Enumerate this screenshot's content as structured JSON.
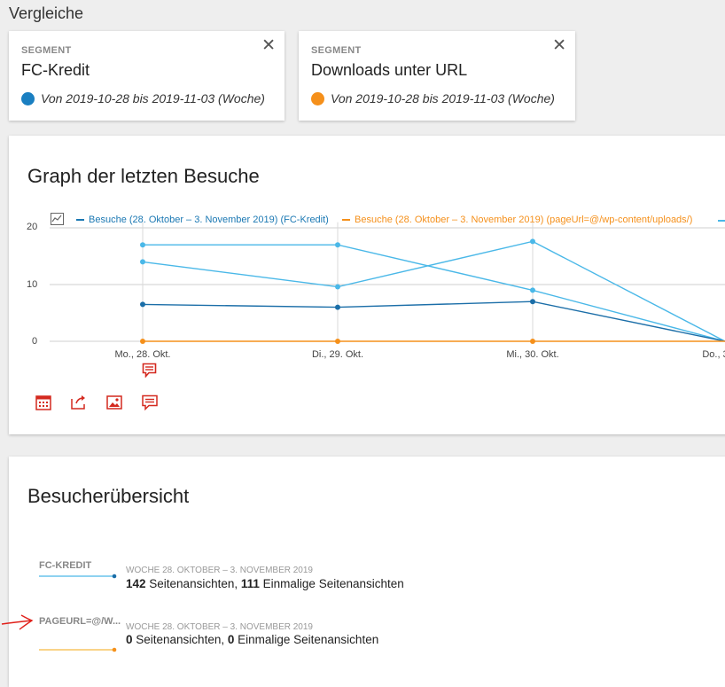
{
  "page": {
    "title": "Vergleiche"
  },
  "segments": [
    {
      "label": "SEGMENT",
      "name": "FC-Kredit",
      "period": "Von 2019-10-28 bis 2019-11-03 (Woche)",
      "color": "#1a7fc1"
    },
    {
      "label": "SEGMENT",
      "name": "Downloads unter URL",
      "period": "Von 2019-10-28 bis 2019-11-03 (Woche)",
      "color": "#f5901b"
    }
  ],
  "graph": {
    "title": "Graph der letzten Besuche",
    "legend": [
      {
        "label": "Besuche (28. Oktober – 3. November 2019) (FC-Kredit)",
        "color": "#1b78b3"
      },
      {
        "label": "Besuche (28. Oktober – 3. November 2019) (pageUrl=@/wp-content/uploads/)",
        "color": "#f5901b"
      }
    ],
    "toolbar": [
      "calendar-icon",
      "export-icon",
      "image-icon",
      "annotation-icon"
    ]
  },
  "chart_data": {
    "type": "line",
    "x": [
      "Mo., 28. Okt.",
      "Di., 29. Okt.",
      "Mi., 30. Okt.",
      "Do., 3"
    ],
    "yticks": [
      0,
      10,
      20
    ],
    "ylim": [
      0,
      21
    ],
    "series": [
      {
        "color": "#4ab8e8",
        "values": [
          17,
          17,
          9,
          0
        ]
      },
      {
        "color": "#4ab8e8",
        "values": [
          14,
          9.6,
          17.6,
          0
        ]
      },
      {
        "name": "Besuche (28. Oktober – 3. November 2019) (FC-Kredit)",
        "color": "#1b6ea8",
        "values": [
          6.5,
          6,
          7,
          0
        ]
      },
      {
        "name": "Besuche (28. Oktober – 3. November 2019) (pageUrl=@/wp-content/uploads/)",
        "color": "#f5901b",
        "values": [
          0,
          0,
          0,
          0
        ]
      }
    ]
  },
  "overview": {
    "title": "Besucherübersicht",
    "rows": [
      {
        "label": "FC-KREDIT",
        "date": "WOCHE 28. OKTOBER – 3. NOVEMBER 2019",
        "views": "142",
        "views_label": " Seitenansichten, ",
        "unique": "111",
        "unique_label": " Einmalige Seitenansichten",
        "color": "#4ab8e8"
      },
      {
        "label": "PAGEURL=@/W...",
        "date": "WOCHE 28. OKTOBER – 3. NOVEMBER 2019",
        "views": "0",
        "views_label": " Seitenansichten, ",
        "unique": "0",
        "unique_label": " Einmalige Seitenansichten",
        "color": "#f5b942"
      }
    ]
  }
}
